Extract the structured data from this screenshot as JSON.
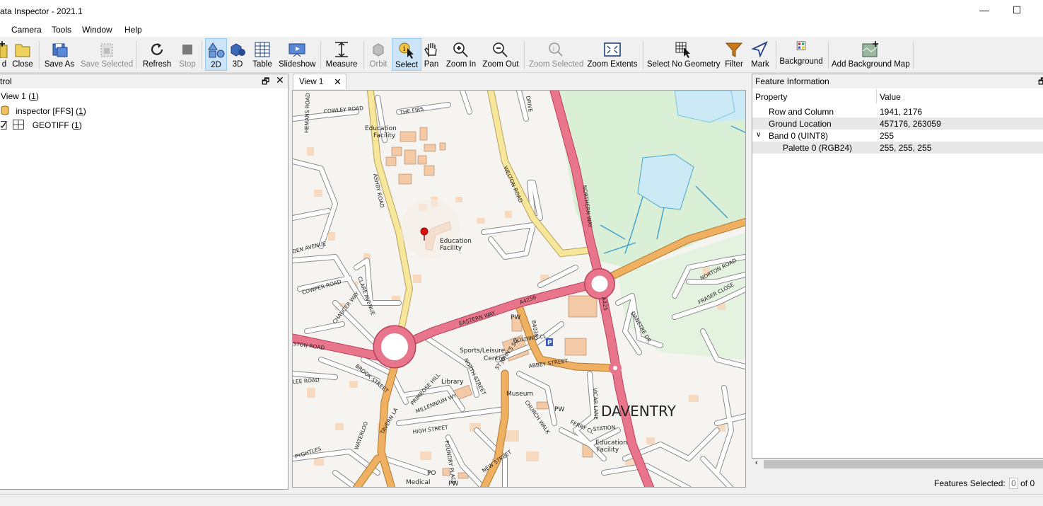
{
  "window": {
    "title": "ata Inspector - 2021.1",
    "minimize": "—",
    "maximize": "☐"
  },
  "menu": [
    "Camera",
    "Tools",
    "Window",
    "Help"
  ],
  "toolbar": {
    "add": "d",
    "close": "Close",
    "save_as": "Save As",
    "save_selected": "Save Selected",
    "refresh": "Refresh",
    "stop": "Stop",
    "view_2d": "2D",
    "view_3d": "3D",
    "table": "Table",
    "slideshow": "Slideshow",
    "measure": "Measure",
    "orbit": "Orbit",
    "select": "Select",
    "pan": "Pan",
    "zoom_in": "Zoom In",
    "zoom_out": "Zoom Out",
    "zoom_selected": "Zoom Selected",
    "zoom_extents": "Zoom Extents",
    "select_no_geometry": "Select No Geometry",
    "filter": "Filter",
    "mark": "Mark",
    "background": "Background",
    "add_background_map": "Add Background Map"
  },
  "control_panel": {
    "title": "trol",
    "tree": [
      {
        "label": "View 1 (",
        "count": "1",
        "suffix": ")"
      },
      {
        "label": "inspector [FFS] (",
        "count": "1",
        "suffix": ")"
      },
      {
        "label": "GEOTIFF (",
        "count": "1",
        "suffix": ")"
      }
    ]
  },
  "tabs": [
    {
      "label": "View 1",
      "close": "✕"
    }
  ],
  "map": {
    "town": "DAVENTRY",
    "labels": {
      "edu1": "Education",
      "edu1b": "Facility",
      "edu2": "Education",
      "edu2b": "Facility",
      "edu3": "Education",
      "edu3b": "Facility",
      "sports": "Sports/Leisure",
      "sports_b": "Centre",
      "library": "Library",
      "museum": "Museum",
      "pw1": "PW",
      "pw2": "PW",
      "pw3": "PW",
      "po": "PO",
      "medical": "Medical",
      "eastern_way": "EASTERN WAY",
      "a4256": "A4256",
      "a425": "A425",
      "northern_way": "NORTHERN WAY",
      "welton_road": "WELTON ROAD",
      "ashby_road": "ASHBY ROAD",
      "cowper_road": "COWPER ROAD",
      "cowley_road": "COWLEY ROAD",
      "the_firs": "THE FIRS",
      "golding_cl": "GOLDING CL",
      "abbey_street": "ABBEY STREET",
      "high_street": "HIGH STREET",
      "new_street": "NEW STREET",
      "norton_road": "NORTON ROAD",
      "fraser_close": "FRASER CLOSE",
      "station": "STATION",
      "vicar_lane": "VICAR LANE",
      "church_walk": "CHURCH WALK",
      "north_street": "NORTH STREET",
      "millennium_wy": "MILLENNIUM WY",
      "prim_rose_hill": "PRIMROSE HILL",
      "brook_street": "BROOK STREET",
      "ston_road": "STON ROAD",
      "lee_road": "LEE ROAD",
      "pyghtles": "PYGHTLES",
      "clare_avenue": "CLARE AVENUE",
      "chaucer_way": "CHAUCER WAY",
      "den_avenue": "DEN AVENUE",
      "hemans_road": "HEMANS ROAD",
      "foundry_place": "FOUNDRY PLACE",
      "b4038": "B4038",
      "st_johns": "ST JOHN'S SQ",
      "tavern_la": "TAVERN LA",
      "waterloo": "WATERLOO",
      "ferry_cl": "FERRY CL",
      "danetre_dr": "DANETRE DR",
      "east_drive": "DRIVE",
      "parking": "P"
    }
  },
  "feature_info": {
    "title": "Feature Information",
    "col_property": "Property",
    "col_value": "Value",
    "rows": [
      {
        "property": "Row and Column",
        "value": "1941, 2176"
      },
      {
        "property": "Ground Location",
        "value": "457176, 263059"
      },
      {
        "property": "Band 0 (UINT8)",
        "value": "255"
      },
      {
        "property": "Palette 0 (RGB24)",
        "value": "255, 255, 255"
      }
    ],
    "features_selected_label": "Features Selected:",
    "features_selected_value": "0",
    "features_total": "of 0"
  },
  "colors": {
    "road_major": "#e8758b",
    "road_secondary": "#f0b062",
    "road_minor": "#ffffff",
    "road_yellow": "#f7e79a",
    "building": "#f4c9a6",
    "green": "#d9efd6",
    "water": "#cbeaf6",
    "selected_blue": "#cce4f7"
  }
}
